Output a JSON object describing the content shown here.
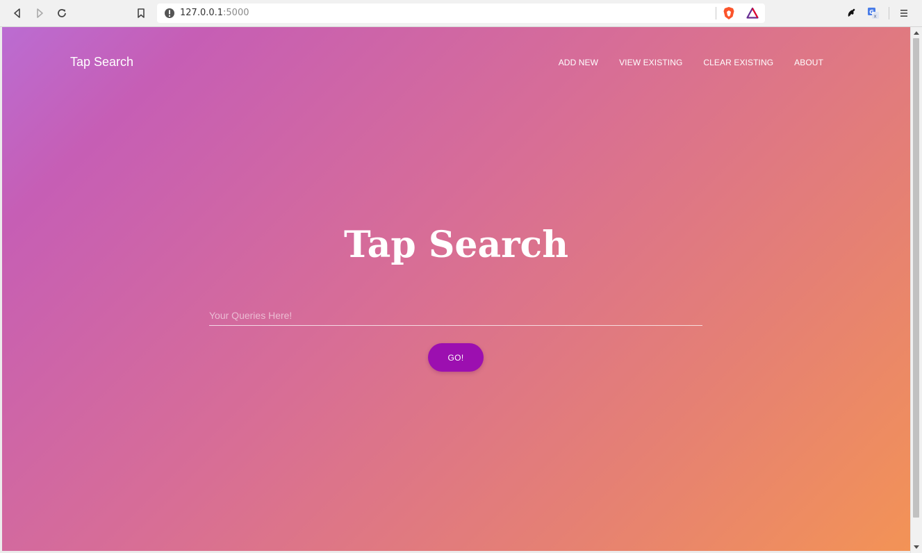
{
  "browser": {
    "url_host": "127.0.0.1",
    "url_port": ":5000"
  },
  "page": {
    "brand": "Tap Search",
    "nav": [
      "ADD NEW",
      "VIEW EXISTING",
      "CLEAR EXISTING",
      "ABOUT"
    ],
    "hero_title": "Tap Search",
    "search_placeholder": "Your Queries Here!",
    "search_value": "",
    "go_label": "GO!"
  },
  "icons": {
    "toolbar": [
      "back-icon",
      "forward-icon",
      "reload-icon",
      "bookmark-icon"
    ],
    "omnibox": [
      "info-icon",
      "brave-shields-icon",
      "brave-rewards-icon"
    ],
    "extensions": [
      "extension-icon",
      "translate-icon",
      "menu-icon"
    ]
  },
  "colors": {
    "gradient_start": "#bb6cd2",
    "gradient_mid": "#d76d97",
    "gradient_end": "#f39356",
    "button": "#9c0fb0"
  }
}
